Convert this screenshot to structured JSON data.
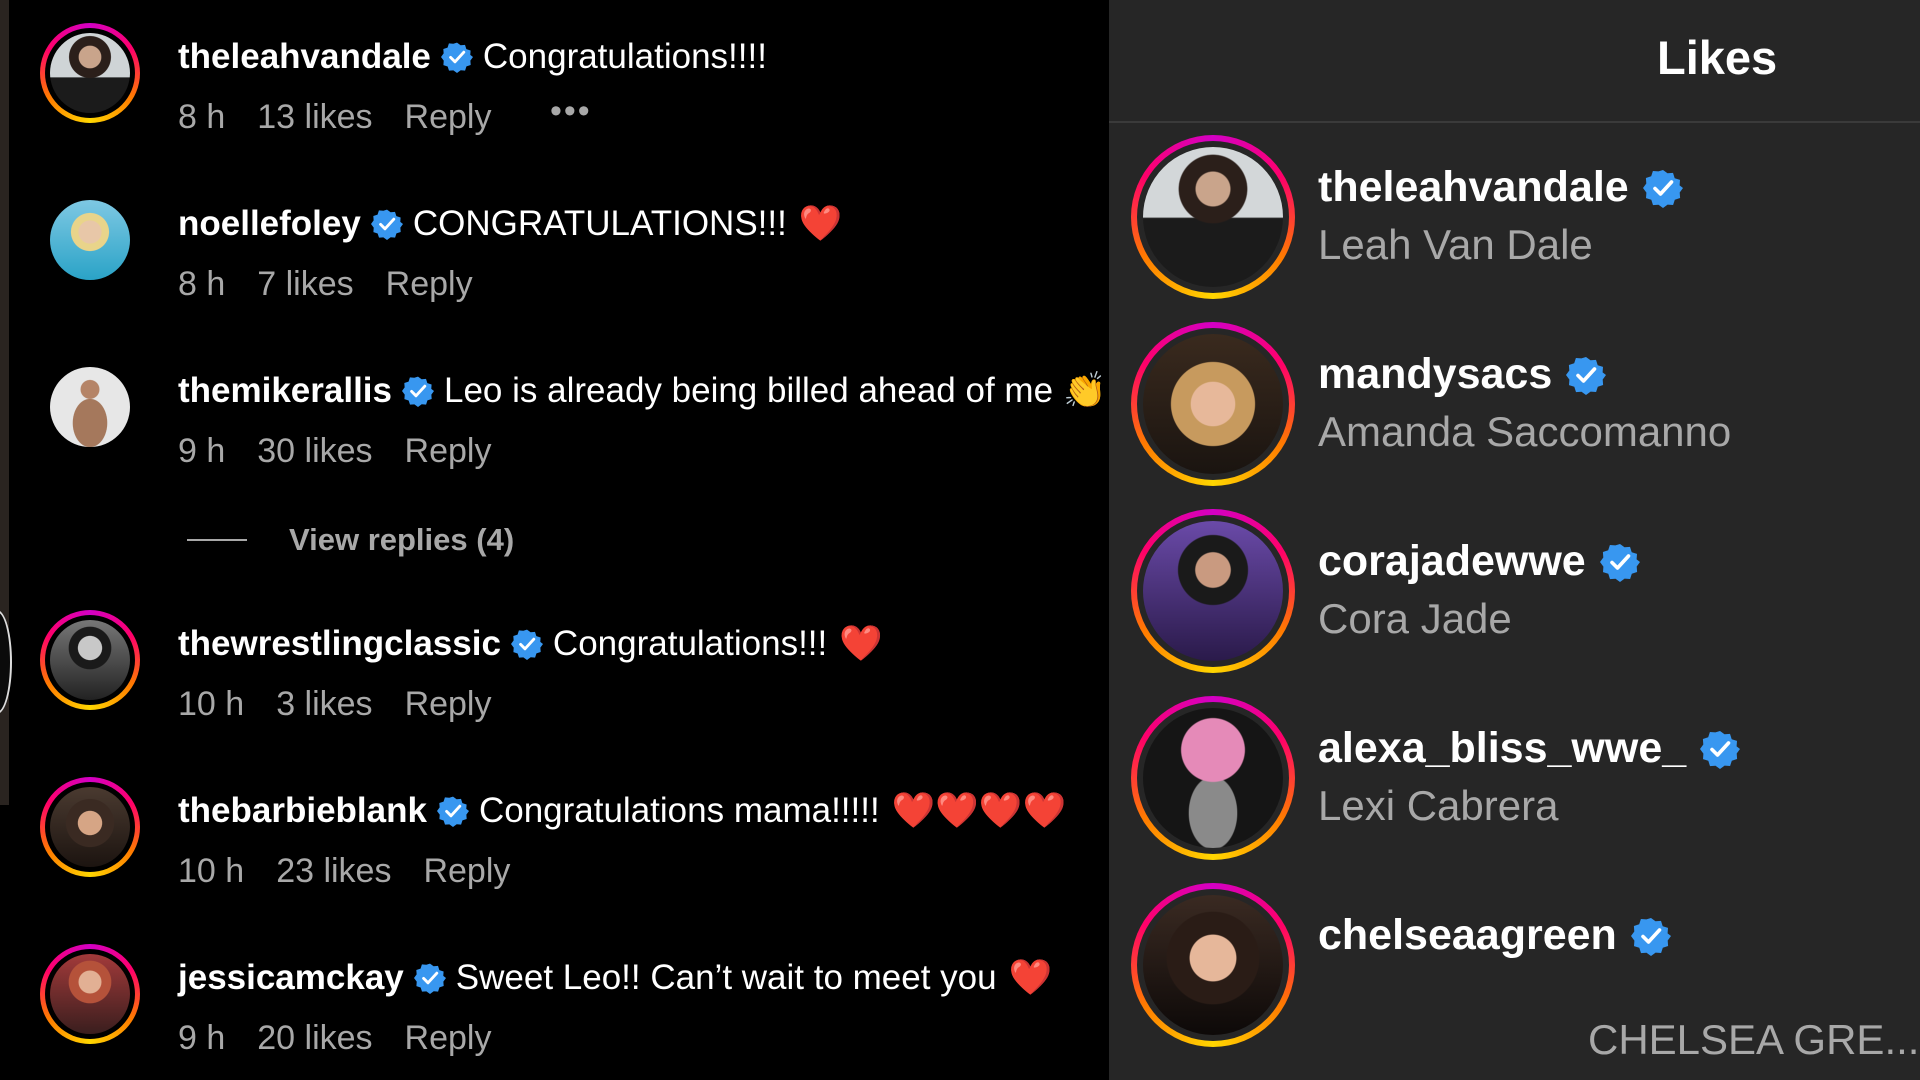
{
  "comments": [
    {
      "username": "theleahvandale",
      "text": "Congratulations!!!!",
      "heart": "",
      "time": "8 h",
      "likes": "13 likes",
      "reply": "Reply",
      "more": "•••"
    },
    {
      "username": "noellefoley",
      "text": "CONGRATULATIONS!!!",
      "heart": "❤️",
      "time": "8 h",
      "likes": "7 likes",
      "reply": "Reply"
    },
    {
      "username": "themikerallis",
      "text": "Leo is already being billed ahead of me",
      "heart": "👏",
      "time": "9 h",
      "likes": "30 likes",
      "reply": "Reply"
    },
    {
      "username": "thewrestlingclassic",
      "text": "Congratulations!!!",
      "heart": "❤️",
      "time": "10 h",
      "likes": "3 likes",
      "reply": "Reply"
    },
    {
      "username": "thebarbieblank",
      "text": "Congratulations mama!!!!!",
      "heart": "❤️❤️❤️❤️",
      "time": "10 h",
      "likes": "23 likes",
      "reply": "Reply"
    },
    {
      "username": "jessicamckay",
      "text": "Sweet Leo!! Can’t wait to meet you",
      "heart": "❤️",
      "time": "9 h",
      "likes": "20 likes",
      "reply": "Reply"
    }
  ],
  "view_replies": "View replies (4)",
  "likes_panel": {
    "title": "Likes",
    "users": [
      {
        "username": "theleahvandale",
        "name": "Leah Van Dale"
      },
      {
        "username": "mandysacs",
        "name": "Amanda Saccomanno"
      },
      {
        "username": "corajadewwe",
        "name": "Cora Jade"
      },
      {
        "username": "alexa_bliss_wwe_",
        "name": "Lexi Cabrera"
      },
      {
        "username": "chelseaagreen",
        "name": "CHELSEA GRE..."
      }
    ]
  },
  "colors": {
    "verified": "#3897f0",
    "heart": "#ff2d3a",
    "muted": "#a8a8a8",
    "panel": "#262626"
  },
  "icons": [
    "verified-badge-icon",
    "more-options-icon"
  ]
}
